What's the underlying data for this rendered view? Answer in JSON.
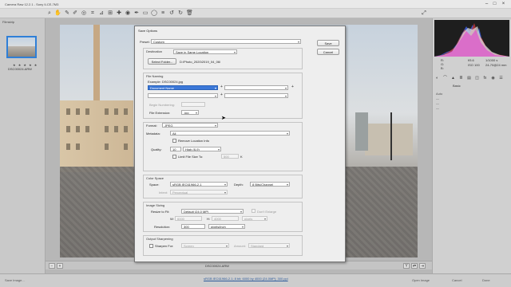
{
  "titlebar": {
    "title": "Camera Raw 12.2.1 - Sony ILCE-7M3"
  },
  "filmstrip": {
    "header": "Filmstrip",
    "thumb_name": "DSC00024.ARW",
    "rating": "★ ★ ★ ★ ★"
  },
  "preview": {
    "zoom_label": "DSC00024.ARW"
  },
  "right_panel": {
    "rgb_values": [
      "R:",
      "G:",
      "B:"
    ],
    "rgb_f": "f/5.6",
    "rgb_shutter": "1/1000 s",
    "rgb_iso": "ISO 100",
    "rgb_lens": "24-70@24 mm",
    "panel_title": "Basic",
    "list_lines": [
      "Auto",
      "—",
      "—",
      "—"
    ]
  },
  "bottombar": {
    "save_image": "Save Image...",
    "workflow": "sRGB IEC61966-2.1; 8 bit; 6000 by 4000 (24.0MP); 300 ppi",
    "open_image": "Open Image",
    "cancel": "Cancel",
    "done": "Done"
  },
  "dialog": {
    "title": "Save Options",
    "preset_label": "Preset:",
    "preset_value": "Custom",
    "save_button": "Save",
    "cancel_button": "Cancel",
    "destination": {
      "title": "Destination",
      "location_value": "Save in Same Location",
      "select_folder_button": "Select Folder...",
      "folder_path": "D:\\Photo_2020\\2019_04_06\\"
    },
    "file_naming": {
      "title": "File Naming",
      "example_label": "Example:",
      "example_value": "DSC00024.jpg",
      "name_field": "Document Name",
      "begin_numbering_label": "Begin Numbering:",
      "extension_label": "File Extension:",
      "extension_value": ".jpg"
    },
    "format": {
      "format_label": "Format:",
      "format_value": "JPEG",
      "metadata_label": "Metadata:",
      "metadata_value": "All",
      "remove_location": "Remove Location Info",
      "quality_label": "Quality:",
      "quality_number": "10",
      "quality_value": "High (8-9)",
      "limit_label": "Limit File Size To:",
      "limit_value": "500",
      "limit_unit": "K"
    },
    "color_space": {
      "title": "Color Space",
      "space_label": "Space:",
      "space_value": "sRGB IEC61966-2.1",
      "depth_label": "Depth:",
      "depth_value": "8 Bits/Channel",
      "intent_label": "Intent:",
      "intent_value": "Perceptual"
    },
    "image_sizing": {
      "title": "Image Sizing",
      "resize_label": "Resize to Fit:",
      "resize_value": "Default (24.0 MP)",
      "dont_enlarge": "Don't Enlarge",
      "w_label": "W:",
      "w_value": "6000",
      "h_label": "H:",
      "h_value": "4000",
      "unit_value": "pixels",
      "resolution_label": "Resolution:",
      "resolution_value": "300",
      "resolution_unit": "pixels/inch"
    },
    "output_sharpening": {
      "title": "Output Sharpening",
      "sharpen_label": "Sharpen For:",
      "sharpen_value": "Screen",
      "amount_label": "Amount:",
      "amount_value": "Standard"
    }
  }
}
